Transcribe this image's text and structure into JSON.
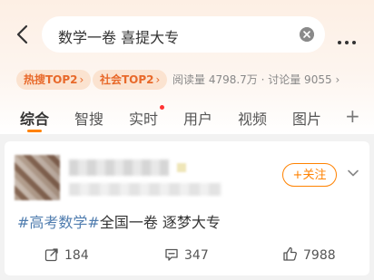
{
  "search": {
    "query": "数学一卷 喜提大专"
  },
  "tags": [
    {
      "label": "热搜TOP2",
      "chevron": "›"
    },
    {
      "label": "社会TOP2",
      "chevron": "›"
    }
  ],
  "stats": {
    "text": "阅读量 4798.7万 · 讨论量 9055",
    "chevron": "›"
  },
  "tabs": [
    {
      "label": "综合"
    },
    {
      "label": "智搜"
    },
    {
      "label": "实时"
    },
    {
      "label": "用户"
    },
    {
      "label": "视频"
    },
    {
      "label": "图片"
    }
  ],
  "tabs_more": "+",
  "post": {
    "follow_label": "+关注",
    "hashtag": "#高考数学#",
    "text": "全国一卷 逐梦大专",
    "actions": {
      "repost": "184",
      "comment": "347",
      "like": "7988"
    }
  },
  "colors": {
    "accent": "#ff8200",
    "hashtag": "#507daf",
    "tag_text": "#e8692a"
  }
}
